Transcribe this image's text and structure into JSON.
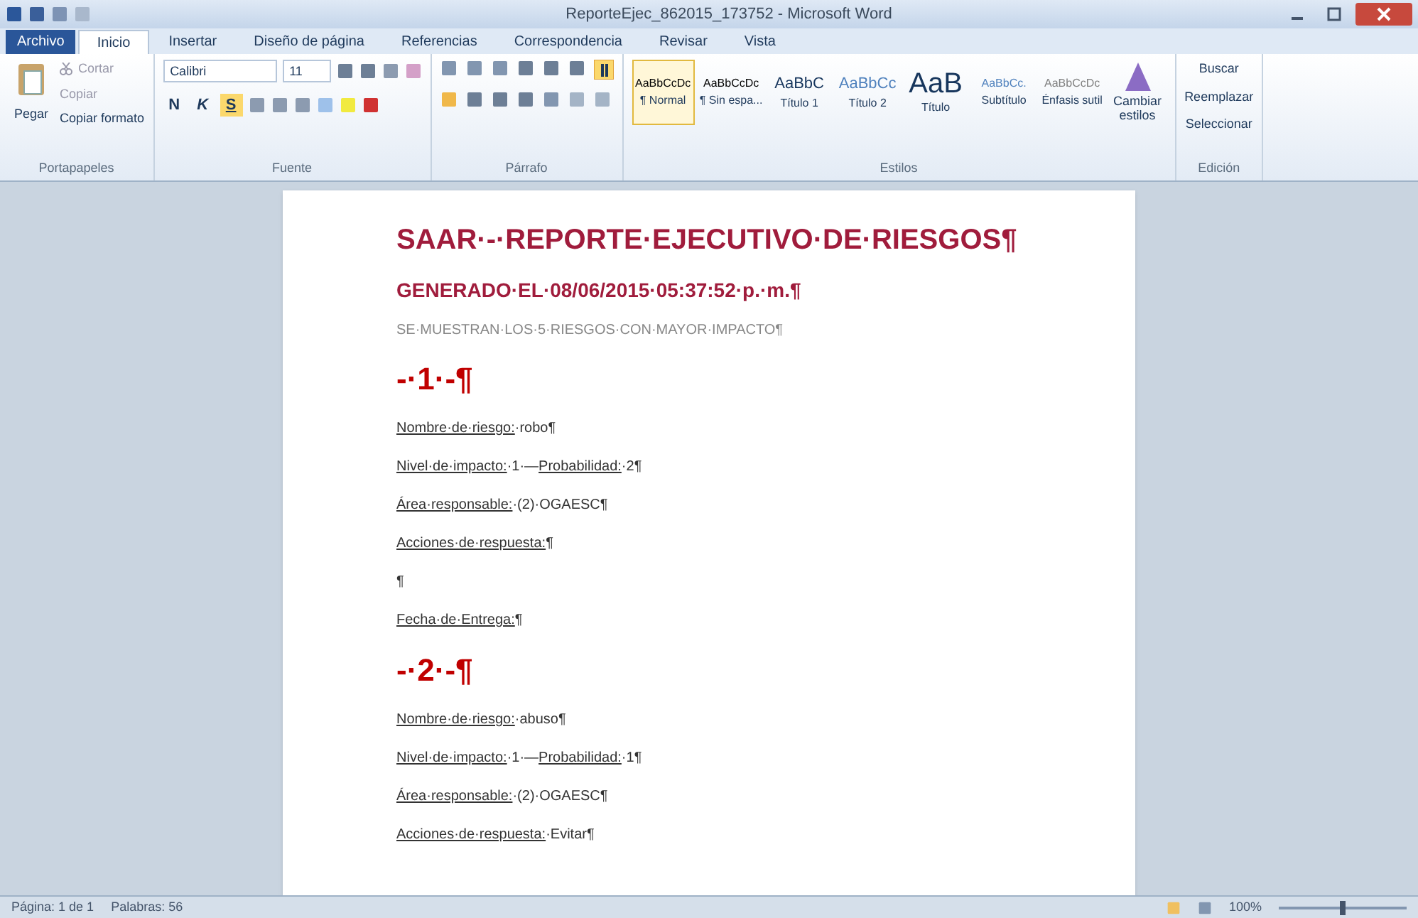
{
  "window": {
    "title": "ReporteEjec_862015_173752 - Microsoft Word"
  },
  "tabs": [
    {
      "label": "Archivo",
      "kind": "file",
      "selected": false
    },
    {
      "label": "Inicio",
      "kind": "tab",
      "selected": true
    },
    {
      "label": "Insertar",
      "kind": "tab",
      "selected": false
    },
    {
      "label": "Diseño de página",
      "kind": "tab",
      "selected": false
    },
    {
      "label": "Referencias",
      "kind": "tab",
      "selected": false
    },
    {
      "label": "Correspondencia",
      "kind": "tab",
      "selected": false
    },
    {
      "label": "Revisar",
      "kind": "tab",
      "selected": false
    },
    {
      "label": "Vista",
      "kind": "tab",
      "selected": false
    }
  ],
  "ribbon": {
    "clipboard": {
      "paste": "Pegar",
      "cut": "Cortar",
      "copy": "Copiar",
      "format_painter": "Copiar formato",
      "group": "Portapapeles"
    },
    "font": {
      "name": "Calibri",
      "size": "11",
      "format_buttons": [
        "N",
        "K",
        "S"
      ],
      "group": "Fuente"
    },
    "paragraph": {
      "group": "Párrafo",
      "show_marks": true
    },
    "styles": {
      "items": [
        {
          "sample": "AaBbCcDc",
          "label": "¶ Normal",
          "selected": true,
          "color": "#000000"
        },
        {
          "sample": "AaBbCcDc",
          "label": "¶ Sin espa...",
          "selected": false,
          "color": "#000000"
        },
        {
          "sample": "AaBbC",
          "label": "Título 1",
          "selected": false,
          "color": "#17365d"
        },
        {
          "sample": "AaBbCc",
          "label": "Título 2",
          "selected": false,
          "color": "#4f81bd"
        },
        {
          "sample": "AaB",
          "label": "Título",
          "selected": false,
          "color": "#17365d"
        },
        {
          "sample": "AaBbCc.",
          "label": "Subtítulo",
          "selected": false,
          "color": "#4f81bd"
        },
        {
          "sample": "AaBbCcDc",
          "label": "Énfasis sutil",
          "selected": false,
          "color": "#808080"
        }
      ],
      "change": "Cambiar estilos",
      "group": "Estilos"
    },
    "editing": {
      "find": "Buscar",
      "replace": "Reemplazar",
      "select": "Seleccionar",
      "group": "Edición"
    }
  },
  "document": [
    {
      "kind": "title",
      "text": "SAAR·-·REPORTE·EJECUTIVO·DE·RIESGOS¶"
    },
    {
      "kind": "subtitle",
      "text": "GENERADO·EL·08/06/2015·05:37:52·p.·m.¶"
    },
    {
      "kind": "note",
      "text": "SE·MUESTRAN·LOS·5·RIESGOS·CON·MAYOR·IMPACTO¶"
    },
    {
      "kind": "number",
      "text": "-·1·-¶"
    },
    {
      "kind": "field",
      "parts": [
        {
          "text": "Nombre·de·riesgo:",
          "underline": true
        },
        {
          "text": "·robo¶",
          "underline": false
        }
      ]
    },
    {
      "kind": "field",
      "parts": [
        {
          "text": "Nivel·de·impacto:",
          "underline": true
        },
        {
          "text": "·1·—",
          "underline": false
        },
        {
          "text": "Probabilidad:",
          "underline": true
        },
        {
          "text": "·2¶",
          "underline": false
        }
      ]
    },
    {
      "kind": "field",
      "parts": [
        {
          "text": "Área·responsable:",
          "underline": true
        },
        {
          "text": "·(2)·OGAESC¶",
          "underline": false
        }
      ]
    },
    {
      "kind": "field",
      "parts": [
        {
          "text": "Acciones·de·respuesta:",
          "underline": true
        },
        {
          "text": "¶",
          "underline": false
        }
      ]
    },
    {
      "kind": "field",
      "parts": [
        {
          "text": "¶",
          "underline": false
        }
      ]
    },
    {
      "kind": "field",
      "parts": [
        {
          "text": "Fecha·de·Entrega:",
          "underline": true
        },
        {
          "text": "¶",
          "underline": false
        }
      ]
    },
    {
      "kind": "number",
      "text": "-·2·-¶"
    },
    {
      "kind": "field",
      "parts": [
        {
          "text": "Nombre·de·riesgo:",
          "underline": true
        },
        {
          "text": "·abuso¶",
          "underline": false
        }
      ]
    },
    {
      "kind": "field",
      "parts": [
        {
          "text": "Nivel·de·impacto:",
          "underline": true
        },
        {
          "text": "·1·—",
          "underline": false
        },
        {
          "text": "Probabilidad:",
          "underline": true
        },
        {
          "text": "·1¶",
          "underline": false
        }
      ]
    },
    {
      "kind": "field",
      "parts": [
        {
          "text": "Área·responsable:",
          "underline": true
        },
        {
          "text": "·(2)·OGAESC¶",
          "underline": false
        }
      ]
    },
    {
      "kind": "field",
      "parts": [
        {
          "text": "Acciones·de·respuesta:",
          "underline": true
        },
        {
          "text": "·Evitar¶",
          "underline": false
        }
      ]
    }
  ],
  "status_bar": {
    "page": "Página: 1 de 1",
    "words": "Palabras: 56",
    "zoom": "100%",
    "zoom_slider": {
      "level": 0.5
    }
  }
}
